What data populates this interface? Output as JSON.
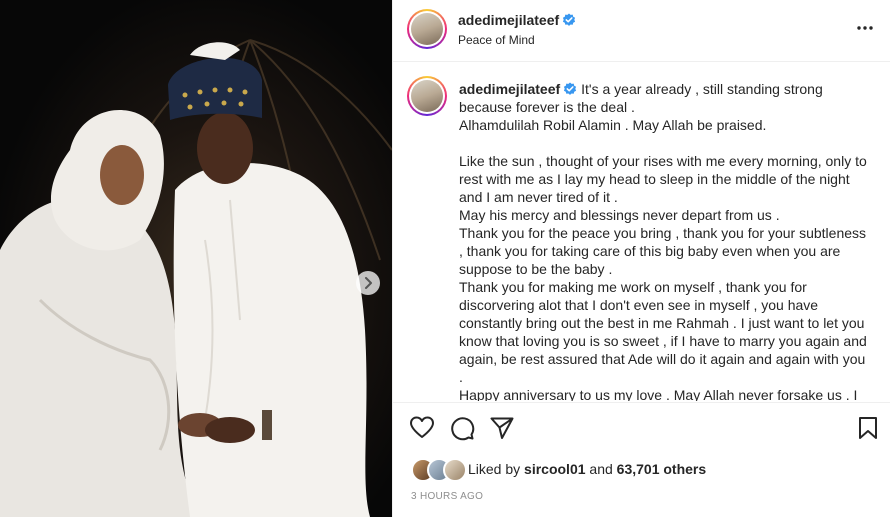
{
  "post": {
    "username": "adedimejilateef",
    "location": "Peace of Mind"
  },
  "caption": {
    "username": "adedimejilateef",
    "lines": [
      "It's a year already , still standing strong because forever is the deal .",
      "Alhamdulilah Robil Alamin . May Allah be praised.",
      "",
      "Like the sun , thought of your rises with me every morning, only to rest with me as I lay my head to sleep in the middle of the night and I am never tired of it .",
      "May his mercy and blessings never depart from us .",
      "Thank you for the peace you bring , thank you for your subtleness , thank you for taking care of this big baby even when you are suppose to be the baby .",
      "Thank you for making me work on myself , thank you for discorvering alot that I don't even see in myself , you have constantly bring out the best in me Rahmah . I just want to let you know that loving you is so sweet , if I have to marry you again and again, be rest assured that Ade will do it again and again with you .",
      "Happy anniversary to us my love . May Allah never forsake us . I"
    ]
  },
  "likes": {
    "prefix": "Liked by",
    "user": "sircool01",
    "and": "and",
    "count": "63,701 others"
  },
  "timestamp": "3 HOURS AGO",
  "icons": [
    "heart-icon",
    "comment-icon",
    "share-icon",
    "bookmark-icon",
    "more-icon",
    "chevron-right-icon",
    "verified-badge-icon"
  ],
  "colors": {
    "verified": "#3897f0",
    "text": "#262626",
    "muted": "#8e8e8e",
    "border": "#efefef"
  }
}
